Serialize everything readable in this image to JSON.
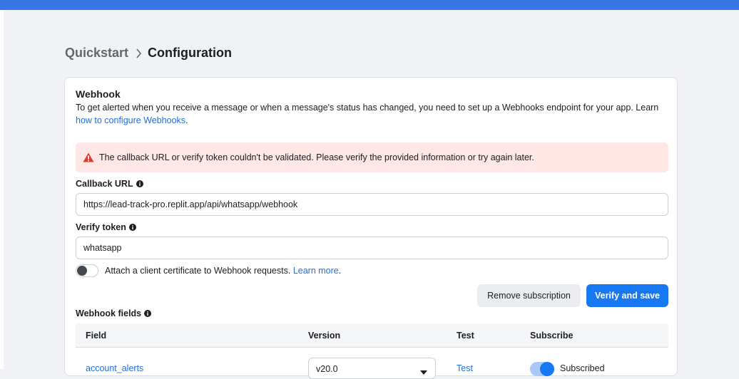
{
  "breadcrumb": {
    "parent": "Quickstart",
    "current": "Configuration"
  },
  "webhook": {
    "title": "Webhook",
    "description_prefix": "To get alerted when you receive a message or when a message's status has changed, you need to set up a Webhooks endpoint for your app. Learn",
    "description_link": "how to configure Webhooks",
    "description_suffix": "."
  },
  "alert": {
    "message": "The callback URL or verify token couldn't be validated. Please verify the provided information or try again later.",
    "icon": "warning-triangle-icon",
    "color": "#e0392b"
  },
  "callback_url": {
    "label": "Callback URL",
    "value": "https://lead-track-pro.replit.app/api/whatsapp/webhook"
  },
  "verify_token": {
    "label": "Verify token",
    "value": "whatsapp"
  },
  "client_certificate": {
    "label": "Attach a client certificate to Webhook requests.",
    "link": "Learn more",
    "suffix": ".",
    "enabled": false
  },
  "buttons": {
    "remove": "Remove subscription",
    "save": "Verify and save"
  },
  "webhook_fields": {
    "title": "Webhook fields",
    "columns": [
      "Field",
      "Version",
      "Test",
      "Subscribe"
    ],
    "rows": [
      {
        "field": "account_alerts",
        "version": "v20.0",
        "test": "Test",
        "subscribe": "Subscribed"
      }
    ]
  },
  "colors": {
    "accent": "#1877f2",
    "topbar": "#3578e5",
    "alert_bg": "#ffe7e5"
  }
}
